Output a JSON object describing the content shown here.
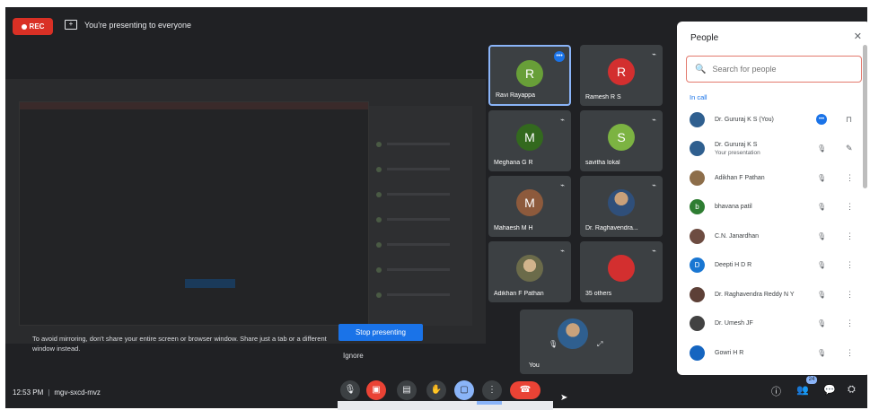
{
  "topbar": {
    "rec_label": "REC",
    "present_icon": "present-icon",
    "presenting_text": "You're presenting to everyone"
  },
  "presenting": {
    "warning": "To avoid mirroring, don't share your entire screen or browser window. Share just a tab or a different window instead.",
    "stop_label": "Stop presenting",
    "ignore_label": "Ignore"
  },
  "tiles": [
    {
      "name": "Ravi Rayappa",
      "initial": "R",
      "color": "#689f38",
      "active": true
    },
    {
      "name": "Ramesh R S",
      "initial": "R",
      "color": "#d32f2f"
    },
    {
      "name": "Meghana G R",
      "initial": "M",
      "color": "#33691e"
    },
    {
      "name": "savitha lokal",
      "initial": "S",
      "color": "#7cb342"
    },
    {
      "name": "Mahaesh M H",
      "initial": "M",
      "color": "#8d5a3c"
    },
    {
      "name": "Dr. Raghavendra...",
      "initial": "",
      "color": "#2f5f8f"
    },
    {
      "name": "Adikhan F Pathan",
      "initial": "",
      "color": "#6b6b4a"
    },
    {
      "name": "35 others",
      "initial": "",
      "color": "#d32f2f"
    }
  ],
  "self_tile": {
    "name": "You"
  },
  "bottom": {
    "time": "12:53 PM",
    "meeting_code": "mgv-sxcd-mvz",
    "people_count": "24"
  },
  "people_panel": {
    "title": "People",
    "search_placeholder": "Search for people",
    "section": "In call",
    "participants": [
      {
        "name": "Dr. Gururaj K S (You)",
        "sub": "",
        "color": "#2f5f8f",
        "initial": ""
      },
      {
        "name": "Dr. Gururaj K S",
        "sub": "Your presentation",
        "color": "#2f5f8f",
        "initial": ""
      },
      {
        "name": "Adikhan F Pathan",
        "sub": "",
        "color": "#8d6e4a",
        "initial": ""
      },
      {
        "name": "bhavana patil",
        "sub": "",
        "color": "#2e7d32",
        "initial": "b"
      },
      {
        "name": "C.N. Janardhan",
        "sub": "",
        "color": "#6d4c41",
        "initial": ""
      },
      {
        "name": "Deepti H D R",
        "sub": "",
        "color": "#1976d2",
        "initial": "D"
      },
      {
        "name": "Dr. Raghavendra Reddy N Y",
        "sub": "",
        "color": "#5d4037",
        "initial": ""
      },
      {
        "name": "Dr. Umesh JF",
        "sub": "",
        "color": "#424242",
        "initial": ""
      },
      {
        "name": "Gowri H R",
        "sub": "",
        "color": "#1565c0",
        "initial": ""
      }
    ]
  },
  "colors": {
    "accent": "#1a73e8",
    "danger": "#ea4335",
    "background": "#202124"
  }
}
